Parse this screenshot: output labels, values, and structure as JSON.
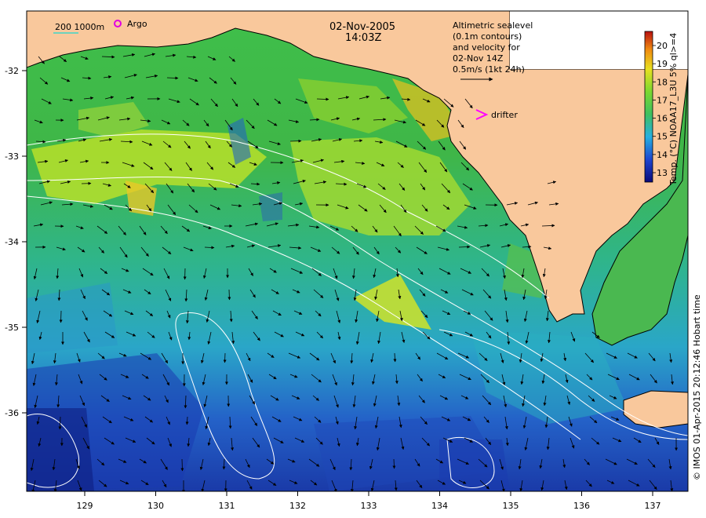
{
  "header": {
    "date": "02-Nov-2005",
    "time": "14:03Z"
  },
  "legend": {
    "depth_contours": "200  1000m",
    "argo": "Argo",
    "drifter": "drifter",
    "altimetry_lines": [
      "Altimetric sealevel",
      "(0.1m contours)",
      "and velocity for",
      "02-Nov 14Z",
      "0.5m/s (1kt 24h)"
    ]
  },
  "colorbar": {
    "title": "Temp. (°C) NOAA17_L3U 5% ql>=4",
    "ticks": [
      "13",
      "14",
      "15",
      "16",
      "17",
      "18",
      "19",
      "20"
    ]
  },
  "axes": {
    "x_ticks": [
      "129",
      "130",
      "131",
      "132",
      "133",
      "134",
      "135",
      "136",
      "137"
    ],
    "y_ticks": [
      "-32",
      "-33",
      "-34",
      "-35",
      "-36"
    ]
  },
  "credit": "© IMOS 01-Apr-2015 20:12:46 Hobart time",
  "colors": {
    "land": "#f9c89c",
    "sst_cold": "#1a3aa8",
    "sst_warm": "#e8d020",
    "contour": "#ffffff",
    "argo_marker": "#e000e0",
    "drifter_marker": "#ff00ff"
  }
}
